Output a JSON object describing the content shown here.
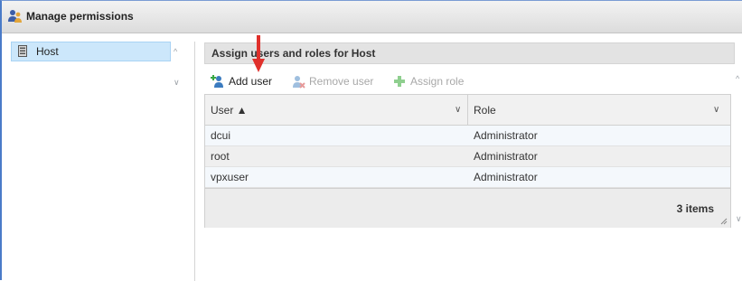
{
  "window": {
    "title": "Manage permissions",
    "title_icon": "users-icon"
  },
  "tree": {
    "items": [
      {
        "label": "Host",
        "icon": "server-icon",
        "selected": true
      }
    ]
  },
  "panel": {
    "title": "Assign users and roles for Host",
    "toolbar": {
      "add_user": "Add user",
      "remove_user": "Remove user",
      "assign_role": "Assign role"
    },
    "table": {
      "columns": {
        "user": "User ▲",
        "role": "Role"
      },
      "rows": [
        {
          "user": "dcui",
          "role": "Administrator"
        },
        {
          "user": "root",
          "role": "Administrator"
        },
        {
          "user": "vpxuser",
          "role": "Administrator"
        }
      ],
      "footer": "3 items"
    }
  },
  "colors": {
    "selection": "#cce7fb",
    "accent_border": "#4a7bc8",
    "annotation_arrow": "#e0302b",
    "disabled_text": "#a8a8a8"
  }
}
